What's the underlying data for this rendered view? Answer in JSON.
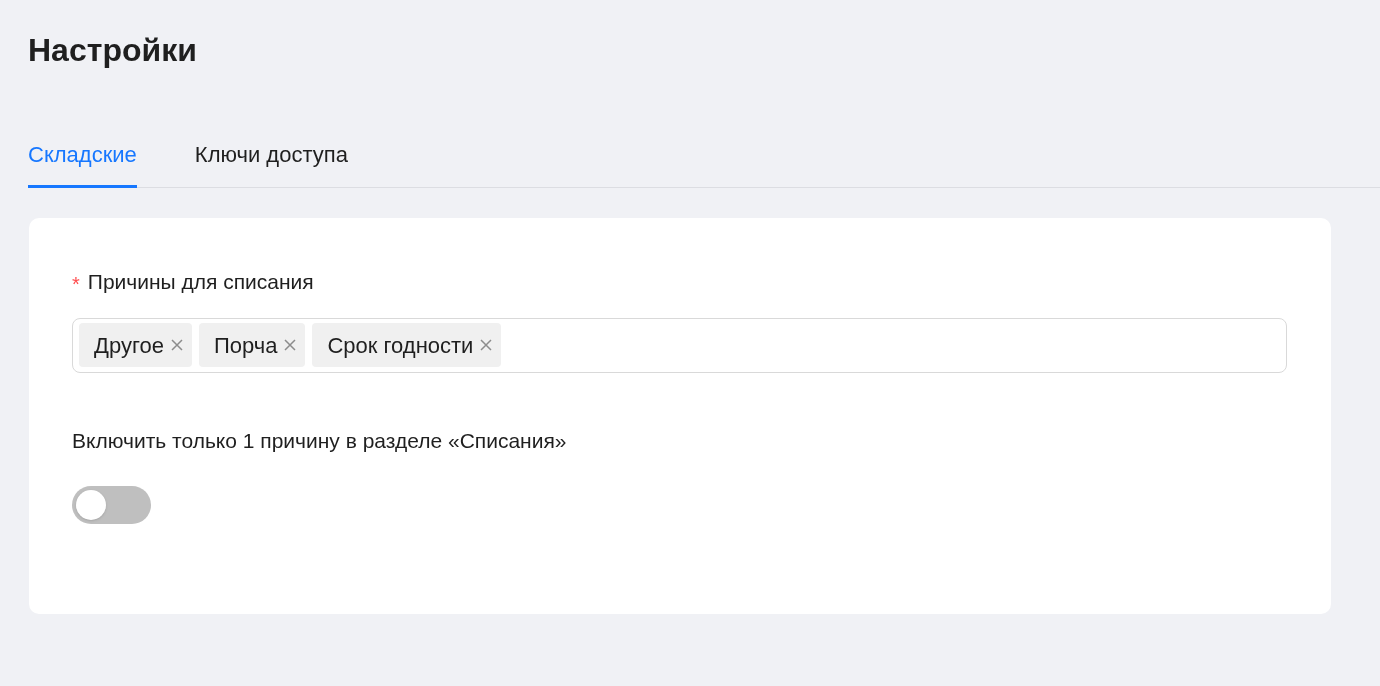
{
  "page": {
    "title": "Настройки"
  },
  "tabs": [
    {
      "label": "Складские",
      "selected": true
    },
    {
      "label": "Ключи доступа",
      "selected": false
    }
  ],
  "form": {
    "reasons_field": {
      "label": "Причины для списания",
      "required_mark": "*",
      "tags": [
        "Другое",
        "Порча",
        "Срок годности"
      ]
    },
    "single_reason": {
      "label": "Включить только 1 причину в разделе «Списания»",
      "on": false
    }
  }
}
